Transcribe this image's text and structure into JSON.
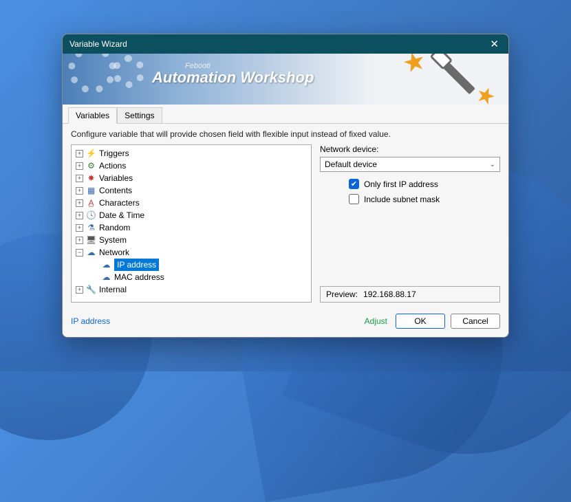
{
  "window": {
    "title": "Variable Wizard"
  },
  "banner": {
    "small": "Febooti",
    "big": "Automation Workshop"
  },
  "tabs": [
    {
      "label": "Variables",
      "active": true
    },
    {
      "label": "Settings",
      "active": false
    }
  ],
  "hint": "Configure variable that will provide chosen field with flexible input instead of fixed value.",
  "tree": [
    {
      "label": "Triggers",
      "icon": "⚡",
      "iconColor": "#f0a020",
      "expandable": true,
      "expanded": false
    },
    {
      "label": "Actions",
      "icon": "⚙",
      "iconColor": "#3a7a3a",
      "expandable": true,
      "expanded": false
    },
    {
      "label": "Variables",
      "icon": "✸",
      "iconColor": "#c04040",
      "expandable": true,
      "expanded": false
    },
    {
      "label": "Contents",
      "icon": "▦",
      "iconColor": "#3a6ab0",
      "expandable": true,
      "expanded": false
    },
    {
      "label": "Characters",
      "icon": "A̲",
      "iconColor": "#c04040",
      "expandable": true,
      "expanded": false
    },
    {
      "label": "Date & Time",
      "icon": "🕓",
      "iconColor": "#c04040",
      "expandable": true,
      "expanded": false
    },
    {
      "label": "Random",
      "icon": "⚗",
      "iconColor": "#3a6ab0",
      "expandable": true,
      "expanded": false
    },
    {
      "label": "System",
      "icon": "🖥",
      "iconColor": "#555",
      "expandable": true,
      "expanded": false
    },
    {
      "label": "Network",
      "icon": "☁",
      "iconColor": "#3a6ab0",
      "expandable": true,
      "expanded": true,
      "children": [
        {
          "label": "IP address",
          "icon": "☁",
          "iconColor": "#3a6ab0",
          "selected": true
        },
        {
          "label": "MAC address",
          "icon": "☁",
          "iconColor": "#3a6ab0",
          "selected": false
        }
      ]
    },
    {
      "label": "Internal",
      "icon": "🔧",
      "iconColor": "#3a6ab0",
      "expandable": true,
      "expanded": false
    }
  ],
  "rightpane": {
    "device_label": "Network device:",
    "device_value": "Default device",
    "only_first_label": "Only first IP address",
    "only_first_checked": true,
    "include_mask_label": "Include subnet mask",
    "include_mask_checked": false,
    "preview_label": "Preview:",
    "preview_value": "192.168.88.17"
  },
  "footer": {
    "left_link": "IP address",
    "adjust": "Adjust",
    "ok": "OK",
    "cancel": "Cancel"
  }
}
